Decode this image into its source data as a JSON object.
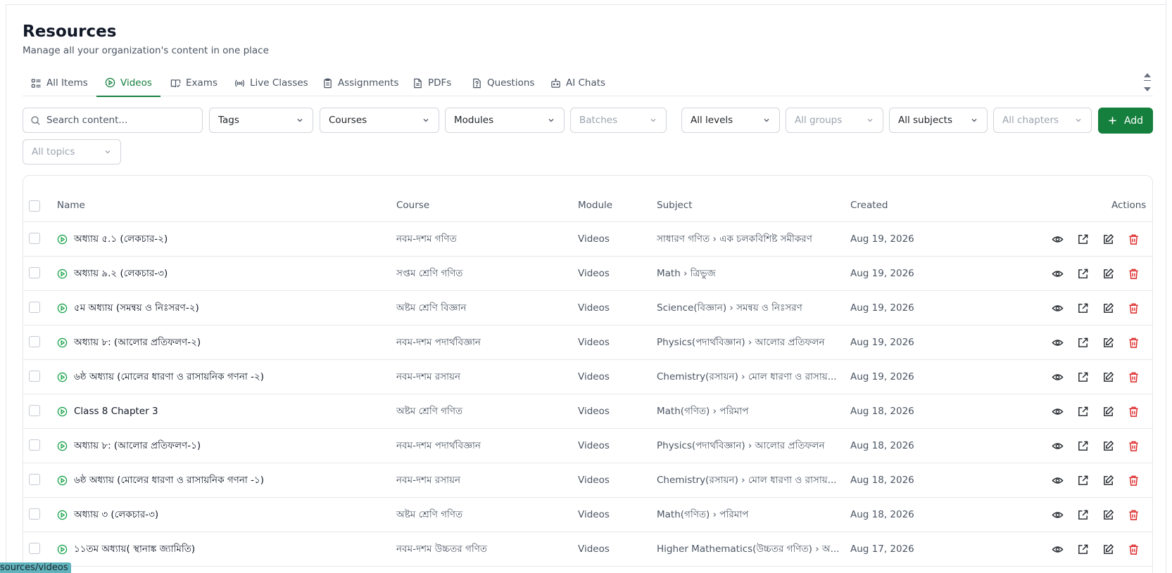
{
  "page": {
    "title": "Resources",
    "subtitle": "Manage all your organization's content in one place"
  },
  "tabs": [
    {
      "label": "All Items",
      "icon": "list-icon"
    },
    {
      "label": "Videos",
      "icon": "play-circle-icon"
    },
    {
      "label": "Exams",
      "icon": "book-check-icon"
    },
    {
      "label": "Live Classes",
      "icon": "broadcast-icon"
    },
    {
      "label": "Assignments",
      "icon": "clipboard-icon"
    },
    {
      "label": "PDFs",
      "icon": "file-icon"
    },
    {
      "label": "Questions",
      "icon": "question-file-icon"
    },
    {
      "label": "AI Chats",
      "icon": "bot-icon"
    }
  ],
  "active_tab": "Videos",
  "filters": {
    "search_placeholder": "Search content...",
    "tags": "Tags",
    "courses": "Courses",
    "modules": "Modules",
    "batches": "Batches",
    "levels": "All levels",
    "groups": "All groups",
    "subjects": "All subjects",
    "chapters": "All chapters",
    "topics": "All topics",
    "add_label": "Add"
  },
  "table": {
    "headers": {
      "name": "Name",
      "course": "Course",
      "module": "Module",
      "subject": "Subject",
      "created": "Created",
      "actions": "Actions"
    },
    "rows": [
      {
        "name": "অধ্যায় ৫.১ (লেকচার-২)",
        "course": "নবম-দশম গণিত",
        "module": "Videos",
        "subject": "সাধারণ গণিত › এক চলকবিশিষ্ট সমীকরণ",
        "created": "Aug 19, 2026"
      },
      {
        "name": "অধ্যায় ৯.২ (লেকচার-৩)",
        "course": "সপ্তম শ্রেণি গণিত",
        "module": "Videos",
        "subject": "Math › ত্রিভুজ",
        "created": "Aug 19, 2026"
      },
      {
        "name": "৫ম অধ্যায় (সমন্বয় ও নিঃসরণ-২)",
        "course": "অষ্টম শ্রেণি বিজ্ঞান",
        "module": "Videos",
        "subject": "Science(বিজ্ঞান) › সমন্বয় ও নিঃসরণ",
        "created": "Aug 19, 2026"
      },
      {
        "name": "অধ্যায় ৮: (আলোর প্রতিফলণ-২)",
        "course": "নবম-দশম পদার্থবিজ্ঞান",
        "module": "Videos",
        "subject": "Physics(পদার্থবিজ্ঞান) › আলোর প্রতিফলন",
        "created": "Aug 19, 2026"
      },
      {
        "name": "৬ষ্ঠ অধ্যায় (মোলের ধারণা ও রাসায়নিক গণনা -২)",
        "course": "নবম-দশম রসায়ন",
        "module": "Videos",
        "subject": "Chemistry(রসায়ন) › মোল ধারণা ও রাসায়...",
        "created": "Aug 19, 2026"
      },
      {
        "name": "Class 8 Chapter 3",
        "course": "অষ্টম শ্রেণি গণিত",
        "module": "Videos",
        "subject": "Math(গণিত) › পরিমাপ",
        "created": "Aug 18, 2026"
      },
      {
        "name": "অধ্যায় ৮: (আলোর প্রতিফলণ-১)",
        "course": "নবম-দশম পদার্থবিজ্ঞান",
        "module": "Videos",
        "subject": "Physics(পদার্থবিজ্ঞান) › আলোর প্রতিফলন",
        "created": "Aug 18, 2026"
      },
      {
        "name": "৬ষ্ঠ অধ্যায় (মোলের ধারণা ও রাসায়নিক গণনা -১)",
        "course": "নবম-দশম রসায়ন",
        "module": "Videos",
        "subject": "Chemistry(রসায়ন) › মোল ধারণা ও রাসায়...",
        "created": "Aug 18, 2026"
      },
      {
        "name": "অধ্যায় ৩ (লেকচার-৩)",
        "course": "অষ্টম শ্রেণি গণিত",
        "module": "Videos",
        "subject": "Math(গণিত) › পরিমাপ",
        "created": "Aug 18, 2026"
      },
      {
        "name": "১১তম অধ্যায়( স্থানাঙ্ক জ্যামিতি)",
        "course": "নবম-দশম উচ্চতর গণিত",
        "module": "Videos",
        "subject": "Higher Mathematics(উচ্চতর গণিত) › অ...",
        "created": "Aug 17, 2026"
      }
    ]
  },
  "status_url": "sources/videos",
  "colors": {
    "accent": "#15803d",
    "delete": "#dc2626",
    "border": "#e5e7eb",
    "status_bar": "#5fb3bd"
  }
}
